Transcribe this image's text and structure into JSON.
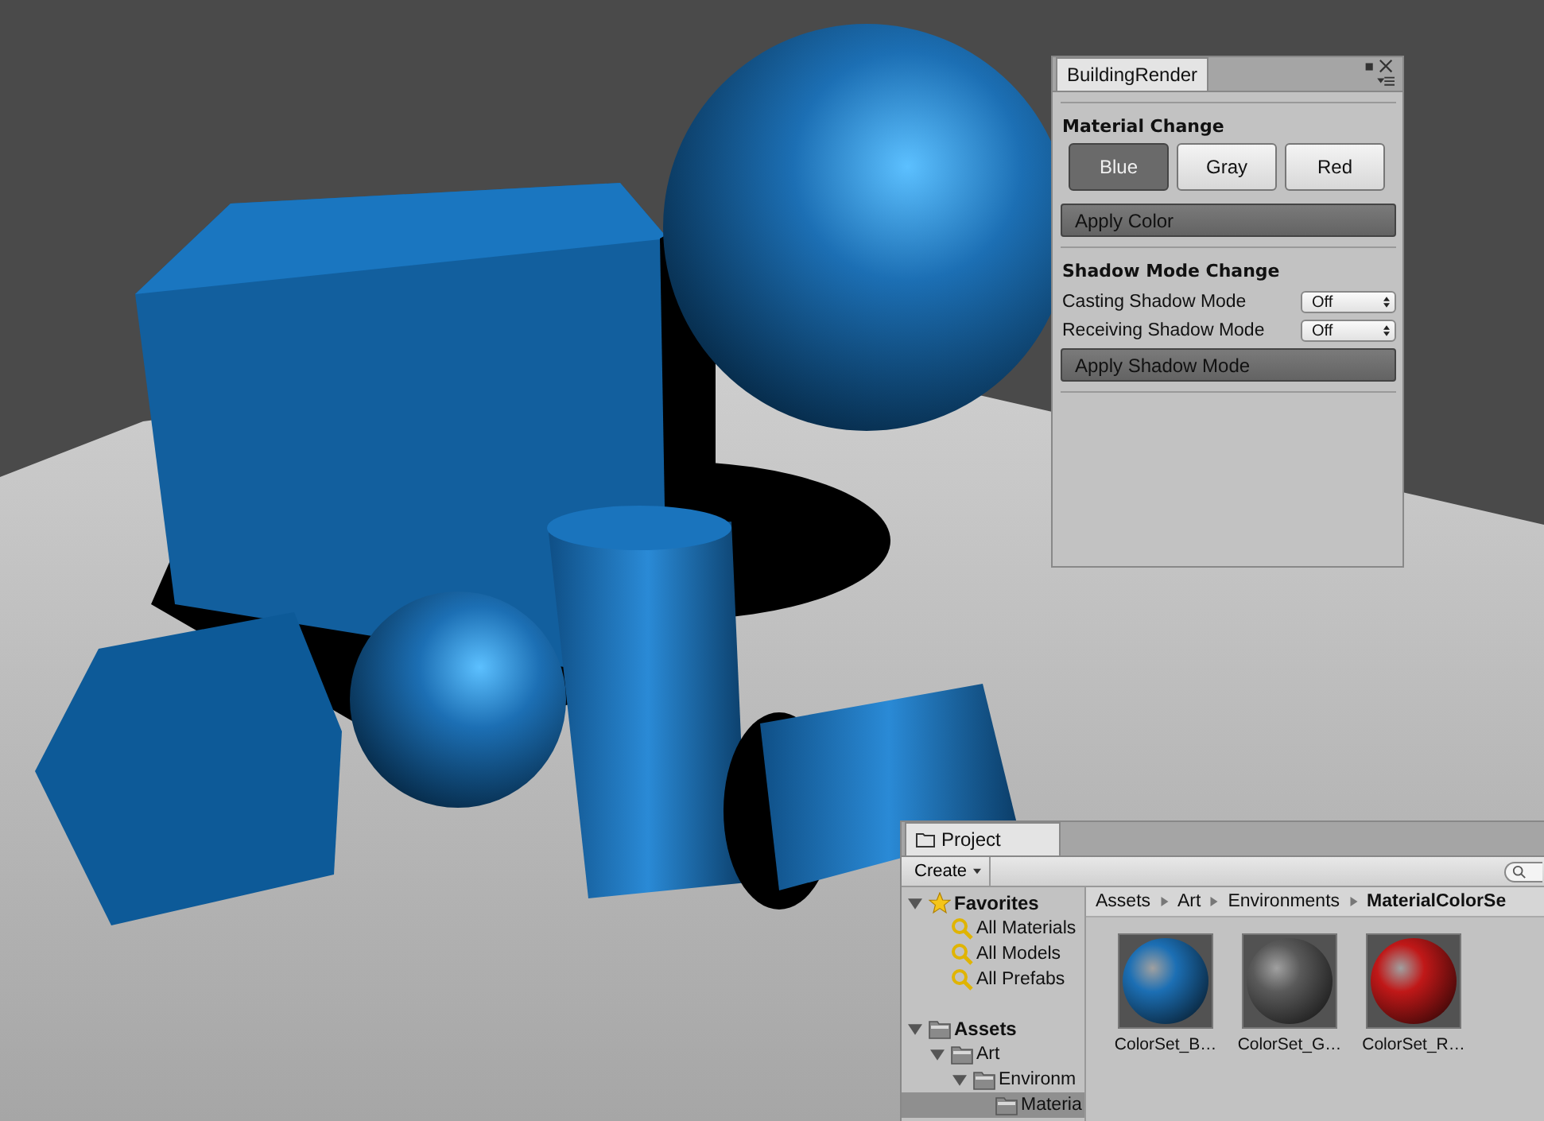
{
  "building_render": {
    "tab": "BuildingRender",
    "material_heading": "Material Change",
    "color_options": [
      {
        "label": "Blue",
        "selected": true
      },
      {
        "label": "Gray",
        "selected": false
      },
      {
        "label": "Red",
        "selected": false
      }
    ],
    "apply_color": "Apply Color",
    "shadow_heading": "Shadow Mode Change",
    "shadow_settings": [
      {
        "label": "Casting Shadow Mode",
        "value": "Off"
      },
      {
        "label": "Receiving Shadow Mode",
        "value": "Off"
      }
    ],
    "apply_shadow": "Apply Shadow Mode"
  },
  "project": {
    "tab": "Project",
    "create_button": "Create",
    "tree": [
      {
        "label": "Favorites",
        "kind": "star",
        "expanded": true,
        "selected": false,
        "children": [
          {
            "label": "All Materials",
            "kind": "search",
            "selected": false
          },
          {
            "label": "All Models",
            "kind": "search",
            "selected": false
          },
          {
            "label": "All Prefabs",
            "kind": "search",
            "selected": false
          }
        ]
      },
      {
        "label": "Assets",
        "kind": "folder",
        "expanded": true,
        "selected": false,
        "children": [
          {
            "label": "Art",
            "kind": "folder",
            "expanded": true,
            "selected": false,
            "children": [
              {
                "label": "Environm",
                "kind": "folder",
                "expanded": true,
                "selected": false,
                "children": [
                  {
                    "label": "Materia",
                    "kind": "folder",
                    "selected": true
                  }
                ]
              }
            ]
          }
        ]
      }
    ],
    "breadcrumb": [
      "Assets",
      "Art",
      "Environments",
      "MaterialColorSe"
    ],
    "assets": [
      {
        "name": "ColorSet_B…",
        "color": "#1c6fb4"
      },
      {
        "name": "ColorSet_G…",
        "color": "#5a5a5a"
      },
      {
        "name": "ColorSet_R…",
        "color": "#c01818"
      }
    ]
  }
}
